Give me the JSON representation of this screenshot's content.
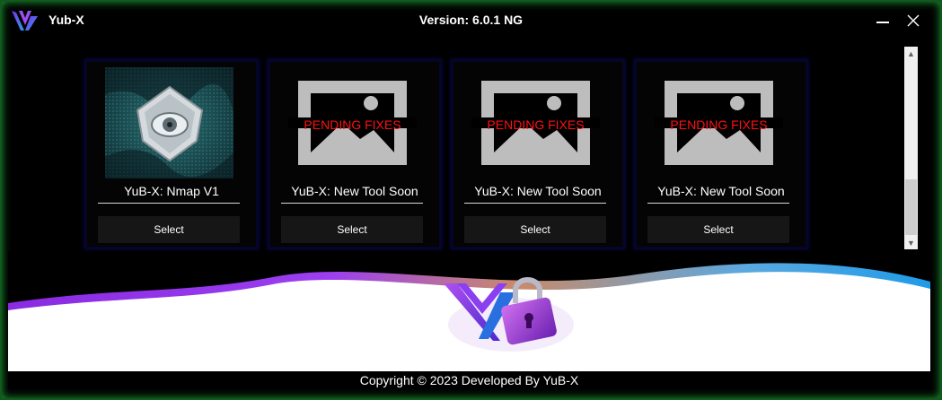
{
  "app": {
    "name": "Yub-X",
    "version": "Version: 6.0.1 NG"
  },
  "window_controls": {
    "minimize_icon": "minimize-icon",
    "close_icon": "close-icon",
    "close_glyph": "✕"
  },
  "tools": [
    {
      "title": "YuB-X: Nmap V1",
      "image": "nmap-eye-image",
      "status": "",
      "select_label": "Select"
    },
    {
      "title": "YuB-X: New Tool Soon",
      "image": "placeholder-image",
      "status": "PENDING FIXES",
      "select_label": "Select"
    },
    {
      "title": "YuB-X: New Tool Soon",
      "image": "placeholder-image",
      "status": "PENDING FIXES",
      "select_label": "Select"
    },
    {
      "title": "YuB-X: New Tool Soon",
      "image": "placeholder-image",
      "status": "PENDING FIXES",
      "select_label": "Select"
    }
  ],
  "scrollbar": {
    "up_glyph": "▲",
    "down_glyph": "▼"
  },
  "footer": {
    "text": "Copyright © 2023 Developed By YuB-X"
  },
  "colors": {
    "accent_purple": "#8a2be2",
    "accent_blue": "#2aa0e8",
    "pending_red": "#ff1010",
    "window_glow": "#1f9a35"
  }
}
